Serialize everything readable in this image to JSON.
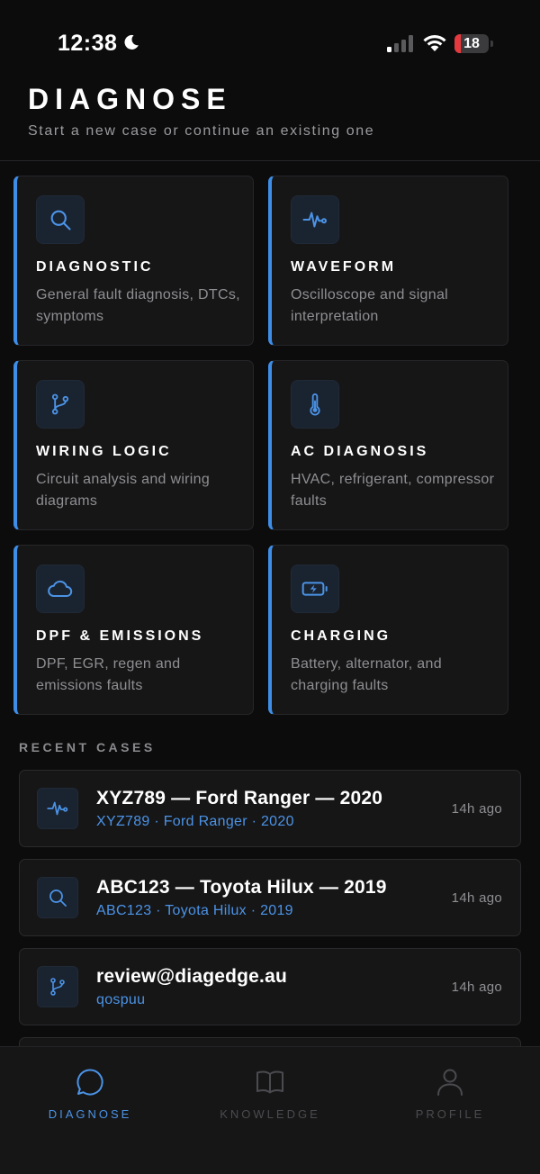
{
  "status_bar": {
    "time": "12:38",
    "battery_level": 18,
    "battery_label": "18"
  },
  "header": {
    "title": "DIAGNOSE",
    "subtitle": "Start a new case or continue an existing one"
  },
  "categories": [
    {
      "title": "DIAGNOSTIC",
      "description": "General fault diagnosis, DTCs, symptoms",
      "icon": "search-icon"
    },
    {
      "title": "WAVEFORM",
      "description": "Oscilloscope and signal interpretation",
      "icon": "waveform-icon"
    },
    {
      "title": "WIRING LOGIC",
      "description": "Circuit analysis and wiring diagrams",
      "icon": "git-branch-icon"
    },
    {
      "title": "AC DIAGNOSIS",
      "description": "HVAC, refrigerant, compressor faults",
      "icon": "thermometer-icon"
    },
    {
      "title": "DPF & EMISSIONS",
      "description": "DPF, EGR, regen and emissions faults",
      "icon": "cloud-icon"
    },
    {
      "title": "CHARGING",
      "description": "Battery, alternator, and charging faults",
      "icon": "battery-charging-icon"
    }
  ],
  "recent": {
    "label": "RECENT CASES",
    "cases": [
      {
        "title": "XYZ789 — Ford Ranger — 2020",
        "subtitle": "XYZ789 · Ford Ranger · 2020",
        "time": "14h ago",
        "icon": "waveform-icon"
      },
      {
        "title": "ABC123 — Toyota Hilux — 2019",
        "subtitle": "ABC123 · Toyota Hilux · 2019",
        "time": "14h ago",
        "icon": "search-icon"
      },
      {
        "title": "review@diagedge.au",
        "subtitle": "qospuu",
        "time": "14h ago",
        "icon": "git-branch-icon"
      }
    ]
  },
  "nav": {
    "items": [
      {
        "label": "DIAGNOSE",
        "icon": "chat-bubble-icon",
        "active": true
      },
      {
        "label": "KNOWLEDGE",
        "icon": "book-icon",
        "active": false
      },
      {
        "label": "PROFILE",
        "icon": "user-icon",
        "active": false
      }
    ]
  },
  "colors": {
    "accent": "#3e8ee8",
    "link": "#4b93e6",
    "background": "#0c0c0d",
    "card": "#161617",
    "battery_low": "#e5393e"
  }
}
